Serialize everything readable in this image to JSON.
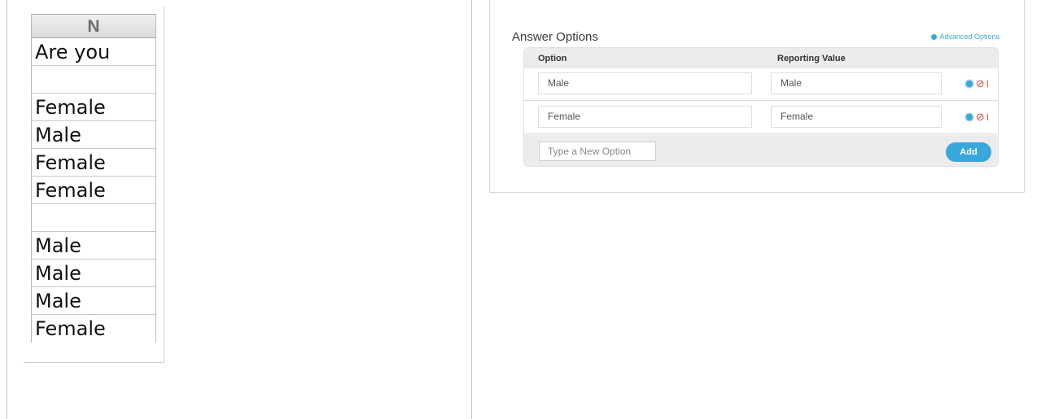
{
  "spreadsheet": {
    "column_header": "N",
    "cells": [
      "Are you",
      "",
      "Female",
      "Male",
      "Female",
      "Female",
      "",
      "Male",
      "Male",
      "Male",
      "Female"
    ]
  },
  "answer_options": {
    "title": "Answer Options",
    "advanced_link": "Advanced Options",
    "columns": {
      "option": "Option",
      "reporting_value": "Reporting Value"
    },
    "rows": [
      {
        "option": "Male",
        "reporting_value": "Male"
      },
      {
        "option": "Female",
        "reporting_value": "Female"
      }
    ],
    "new_option_placeholder": "Type a New Option",
    "add_label": "Add"
  },
  "icons": {
    "gear": "gear-icon",
    "remove": "no-entry-icon",
    "drag": "drag-handle-icon"
  },
  "colors": {
    "accent": "#39a7d9",
    "remove": "#d84a3a",
    "drag": "#d36b2a"
  }
}
